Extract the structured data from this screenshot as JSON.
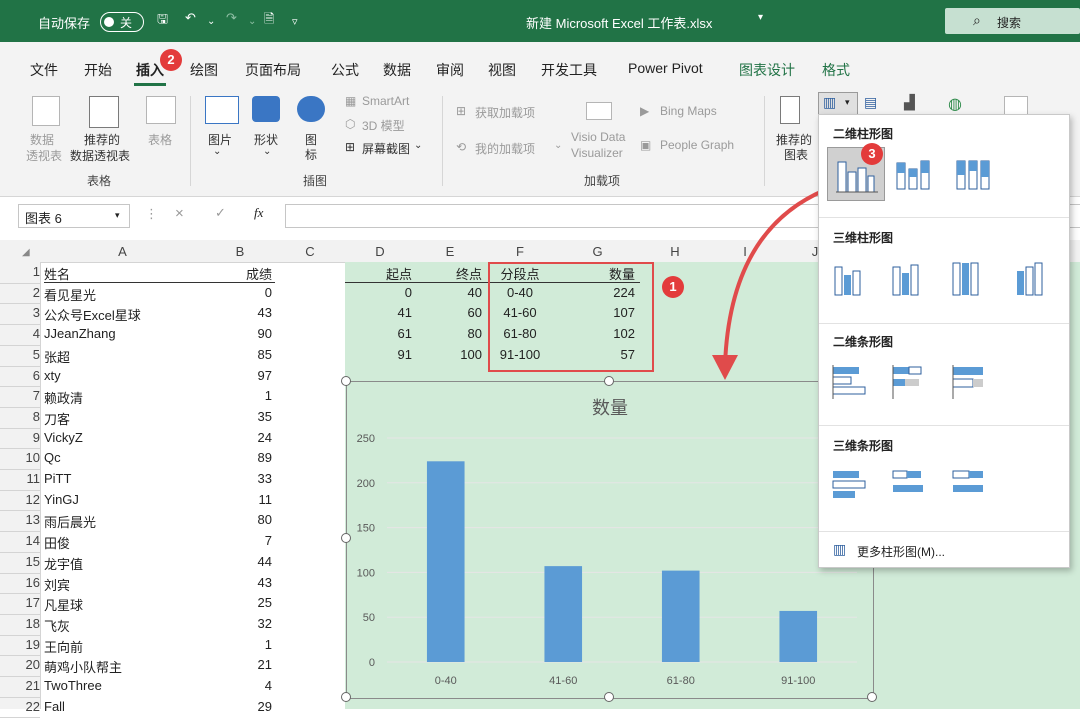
{
  "titlebar": {
    "autosave_label": "自动保存",
    "autosave_state": "关",
    "doc_title": "新建 Microsoft Excel 工作表.xlsx",
    "search_label": "搜索"
  },
  "tabs": [
    "文件",
    "开始",
    "插入",
    "绘图",
    "页面布局",
    "公式",
    "数据",
    "审阅",
    "视图",
    "开发工具",
    "Power Pivot",
    "图表设计",
    "格式"
  ],
  "badges": [
    "1",
    "2",
    "3"
  ],
  "ribbon": {
    "pivot_label_1": "数据",
    "pivot_label_2": "透视表",
    "recommended_pivot_1": "推荐的",
    "recommended_pivot_2": "数据透视表",
    "table_label": "表格",
    "group_tables": "表格",
    "pictures": "图片",
    "shapes": "形状",
    "icons_1": "图",
    "icons_2": "标",
    "smartart": "SmartArt",
    "model3d": "3D 模型",
    "screenshot": "屏幕截图",
    "group_illustrations": "插图",
    "get_addins": "获取加载项",
    "my_addins": "我的加载项",
    "visio_1": "Visio Data",
    "visio_2": "Visualizer",
    "bing_maps": "Bing Maps",
    "people_graph": "People Graph",
    "group_addins": "加载项",
    "recommended_charts_1": "推荐的",
    "recommended_charts_2": "图表"
  },
  "formula": {
    "namebox": "图表 6",
    "cancel": "×",
    "enter": "✓",
    "fx": "fx"
  },
  "columns": [
    "A",
    "B",
    "C",
    "D",
    "E",
    "F",
    "G",
    "H",
    "I",
    "J"
  ],
  "rows": [
    {
      "n": "1",
      "a": "姓名",
      "b": "成绩",
      "d": "起点",
      "e": "终点",
      "f": "分段点",
      "g": "数量"
    },
    {
      "n": "2",
      "a": "看见星光",
      "b": "0",
      "d": "0",
      "e": "40",
      "f": "0-40",
      "g": "224"
    },
    {
      "n": "3",
      "a": "公众号Excel星球",
      "b": "43",
      "d": "41",
      "e": "60",
      "f": "41-60",
      "g": "107"
    },
    {
      "n": "4",
      "a": "JJeanZhang",
      "b": "90",
      "d": "61",
      "e": "80",
      "f": "61-80",
      "g": "102"
    },
    {
      "n": "5",
      "a": "张超",
      "b": "85",
      "d": "91",
      "e": "100",
      "f": "91-100",
      "g": "57"
    },
    {
      "n": "6",
      "a": "xty",
      "b": "97"
    },
    {
      "n": "7",
      "a": "赖政清",
      "b": "1"
    },
    {
      "n": "8",
      "a": "刀客",
      "b": "35"
    },
    {
      "n": "9",
      "a": "VickyZ",
      "b": "24"
    },
    {
      "n": "10",
      "a": "Qc",
      "b": "89"
    },
    {
      "n": "11",
      "a": "PiTT",
      "b": "33"
    },
    {
      "n": "12",
      "a": "YinGJ",
      "b": "11"
    },
    {
      "n": "13",
      "a": "雨后晨光",
      "b": "80"
    },
    {
      "n": "14",
      "a": "田俊",
      "b": "7"
    },
    {
      "n": "15",
      "a": "龙宇值",
      "b": "44"
    },
    {
      "n": "16",
      "a": "刘宾",
      "b": "43"
    },
    {
      "n": "17",
      "a": "凡星球",
      "b": "25"
    },
    {
      "n": "18",
      "a": "飞灰",
      "b": "32"
    },
    {
      "n": "19",
      "a": "王向前",
      "b": "1"
    },
    {
      "n": "20",
      "a": "萌鸡小队帮主",
      "b": "21"
    },
    {
      "n": "21",
      "a": "TwoThree",
      "b": "4"
    },
    {
      "n": "22",
      "a": "Fall",
      "b": "29"
    }
  ],
  "chart_data": {
    "type": "bar",
    "title": "数量",
    "categories": [
      "0-40",
      "41-60",
      "61-80",
      "91-100"
    ],
    "values": [
      224,
      107,
      102,
      57
    ],
    "yticks": [
      "0",
      "50",
      "100",
      "150",
      "200",
      "250"
    ],
    "ylim": [
      0,
      250
    ],
    "grid": true,
    "bar_color": "#5b9bd5"
  },
  "dropdown": {
    "section_2d_col": "二维柱形图",
    "section_3d_col": "三维柱形图",
    "section_2d_bar": "二维条形图",
    "section_3d_bar": "三维条形图",
    "more": "更多柱形图(M)..."
  },
  "colors": {
    "excel_green": "#217346",
    "badge_red": "#e33b3b",
    "highlight_box": "#e04b4b",
    "chart_bg": "#d1ebd8",
    "bar": "#5b9bd5"
  }
}
